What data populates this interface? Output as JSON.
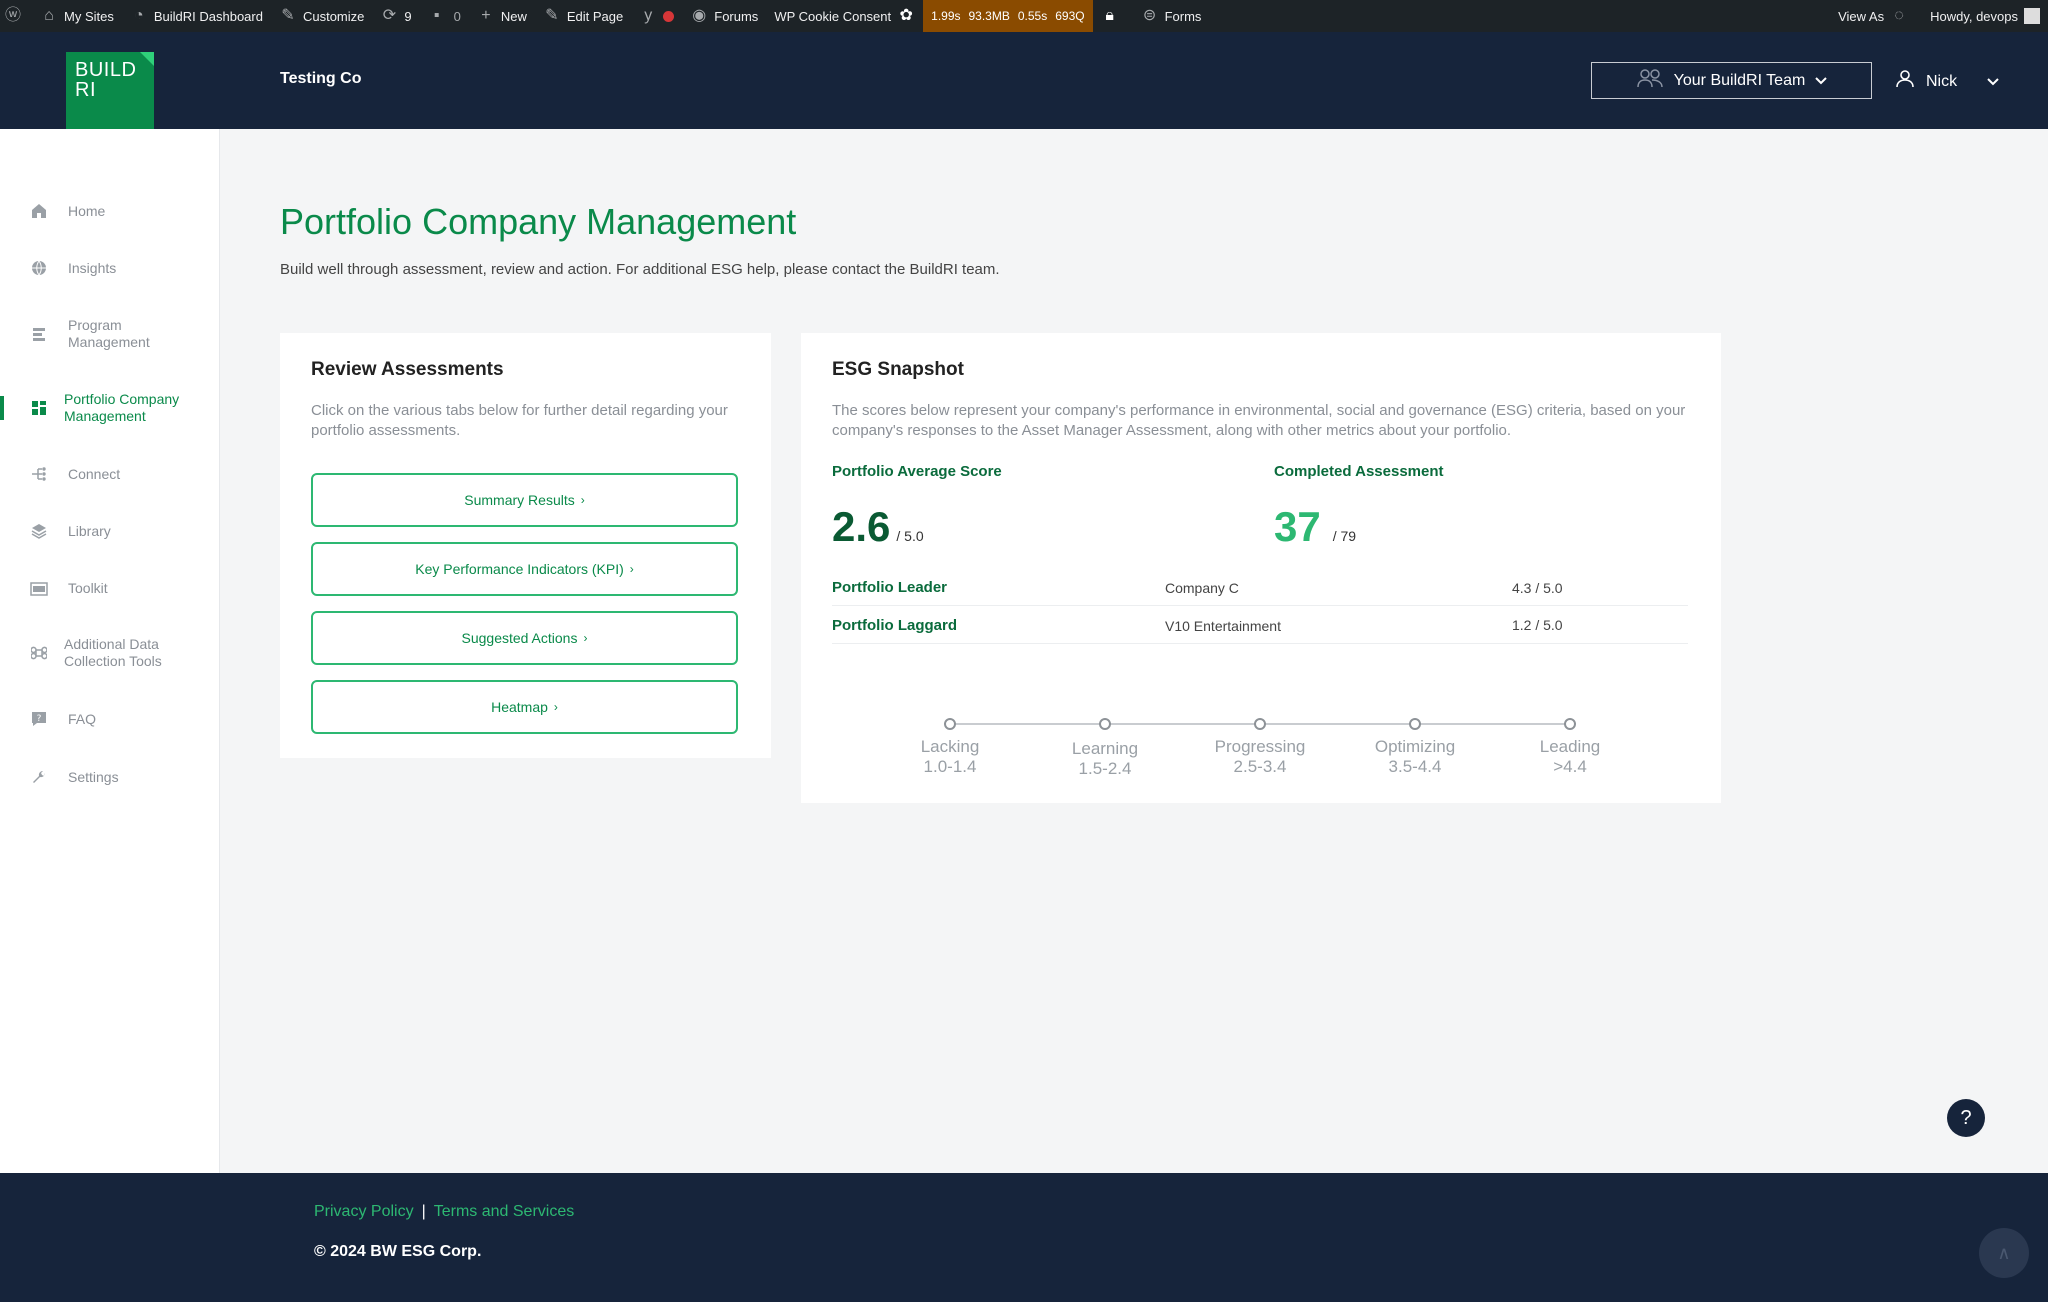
{
  "adminbar": {
    "my_sites": "My Sites",
    "dashboard": "BuildRI Dashboard",
    "customize": "Customize",
    "updates_count": "9",
    "comments_count": "0",
    "new": "New",
    "edit_page": "Edit Page",
    "forums": "Forums",
    "cookie": "WP Cookie Consent",
    "qm": [
      "1.99s",
      "93.3MB",
      "0.55s",
      "693Q"
    ],
    "forms": "Forms",
    "view_as": "View As",
    "howdy": "Howdy, devops"
  },
  "header": {
    "logo": [
      "BUILD",
      "RI"
    ],
    "company": "Testing Co",
    "team_button": "Your BuildRI Team",
    "user": "Nick"
  },
  "sidebar": {
    "items": [
      {
        "label": "Home",
        "icon": "home-icon"
      },
      {
        "label": "Insights",
        "icon": "globe-icon"
      },
      {
        "label": "Program Management",
        "icon": "document-icon"
      },
      {
        "label": "Portfolio Company Management",
        "icon": "grid-icon",
        "active": true
      },
      {
        "label": "Connect",
        "icon": "network-icon"
      },
      {
        "label": "Library",
        "icon": "layers-icon"
      },
      {
        "label": "Toolkit",
        "icon": "toolbox-icon"
      },
      {
        "label": "Additional Data Collection Tools",
        "icon": "command-icon"
      },
      {
        "label": "FAQ",
        "icon": "question-icon"
      },
      {
        "label": "Settings",
        "icon": "wrench-icon"
      }
    ]
  },
  "main": {
    "title": "Portfolio Company Management",
    "subtitle": "Build well through assessment, review and action. For additional ESG help, please contact the BuildRI team."
  },
  "review": {
    "title": "Review Assessments",
    "description": "Click on the various tabs below for further detail regarding your portfolio assessments.",
    "buttons": [
      "Summary Results",
      "Key Performance Indicators (KPI)",
      "Suggested Actions",
      "Heatmap"
    ]
  },
  "esg": {
    "title": "ESG Snapshot",
    "description": "The scores below represent your company's performance in environmental, social and governance (ESG) criteria, based on your company's responses to the Asset Manager Assessment, along with other metrics about your portfolio.",
    "avg_label": "Portfolio Average Score",
    "avg_value": "2.6",
    "avg_max": "/ 5.0",
    "completed_label": "Completed Assessment",
    "completed_value": "37",
    "completed_max": "/ 79",
    "leader_label": "Portfolio Leader",
    "leader_company": "Company C",
    "leader_score": "4.3 / 5.0",
    "laggard_label": "Portfolio Laggard",
    "laggard_company": "V10 Entertainment",
    "laggard_score": "1.2 / 5.0",
    "scale": [
      {
        "name": "Lacking",
        "range": "1.0-1.4"
      },
      {
        "name": "Learning",
        "range": "1.5-2.4"
      },
      {
        "name": "Progressing",
        "range": "2.5-3.4"
      },
      {
        "name": "Optimizing",
        "range": "3.5-4.4"
      },
      {
        "name": "Leading",
        "range": ">4.4"
      }
    ]
  },
  "help": "?",
  "footer": {
    "privacy": "Privacy Policy",
    "separator": "|",
    "terms": "Terms and Services",
    "copyright": "© 2024 BW ESG Corp."
  },
  "colors": {
    "brand_green": "#0a8a4a",
    "navy": "#16243b",
    "accent_green": "#2db872"
  }
}
